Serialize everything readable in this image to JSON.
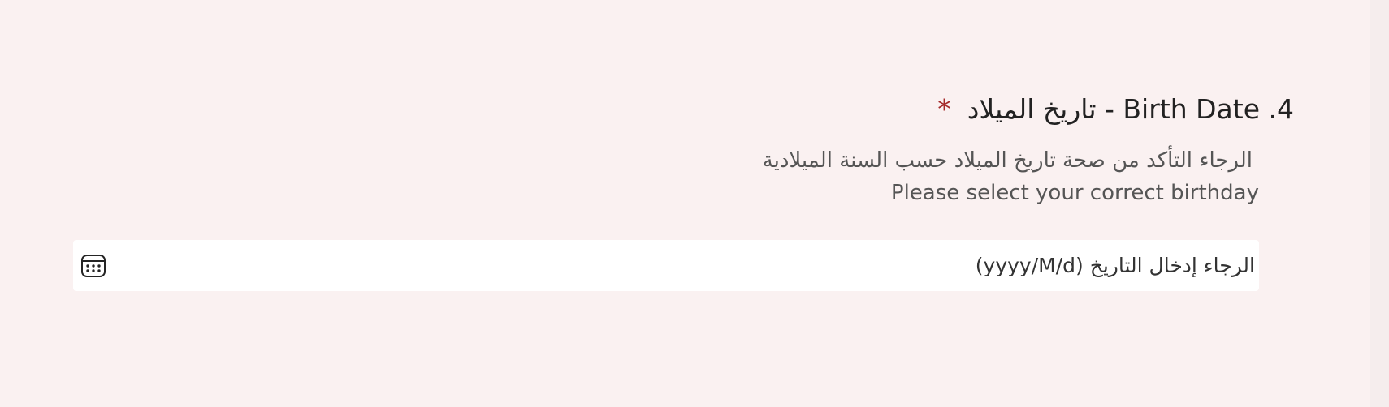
{
  "question": {
    "number": "4.",
    "title": "4. Birth Date - تاريخ الميلاد",
    "required_mark": "*"
  },
  "description": {
    "arabic": "الرجاء التأكد من صحة تاريخ الميلاد حسب السنة الميلادية",
    "english": "Please select your correct birthday"
  },
  "date_input": {
    "placeholder": "الرجاء إدخال التاريخ (yyyy/M/d)"
  },
  "icons": {
    "calendar": "calendar-icon"
  },
  "colors": {
    "page_background": "#faf1f1",
    "required_star": "#a52a2a",
    "field_background": "#ffffff"
  }
}
